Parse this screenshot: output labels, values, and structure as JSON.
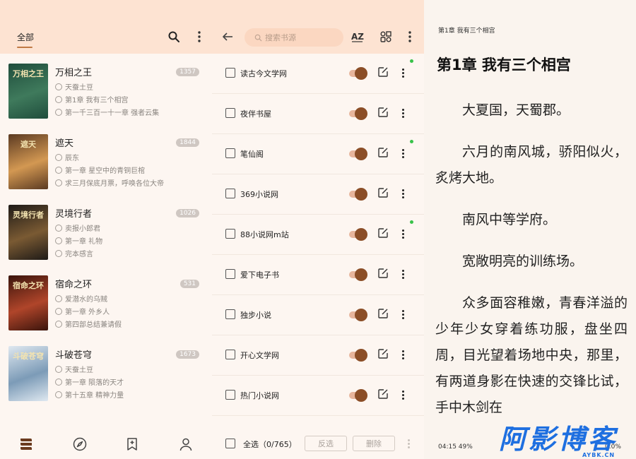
{
  "bookshelf": {
    "tab_all": "全部",
    "icons": {
      "search": "search-icon",
      "more": "more-vert-icon"
    },
    "books": [
      {
        "title": "万相之王",
        "count": "1357",
        "author": "天蚕土豆",
        "read_chapter": "第1章 我有三个相宫",
        "latest_chapter": "第一千三百一十一章 强者云集",
        "cover_text": "万相之王",
        "cover_colors": [
          "#1f4d3c",
          "#3f7a5c"
        ]
      },
      {
        "title": "遮天",
        "count": "1844",
        "author": "辰东",
        "read_chapter": "第一章 星空中的青铜巨棺",
        "latest_chapter": "求三月保底月票，呼唤各位大帝",
        "cover_text": "遮天",
        "cover_colors": [
          "#5b3a22",
          "#d39852"
        ]
      },
      {
        "title": "灵境行者",
        "count": "1026",
        "author": "卖报小郎君",
        "read_chapter": "第一章 礼物",
        "latest_chapter": "完本感言",
        "cover_text": "灵境行者",
        "cover_colors": [
          "#1e1a17",
          "#7a5a33"
        ]
      },
      {
        "title": "宿命之环",
        "count": "531",
        "author": "爱潜水的乌贼",
        "read_chapter": "第一章 外乡人",
        "latest_chapter": "第四部总结兼请假",
        "cover_text": "宿命之环",
        "cover_colors": [
          "#3a140c",
          "#b0452a"
        ]
      },
      {
        "title": "斗破苍穹",
        "count": "1673",
        "author": "天蚕土豆",
        "read_chapter": "第一章 陨落的天才",
        "latest_chapter": "第十五章 精神力量",
        "cover_text": "斗破苍穹",
        "cover_colors": [
          "#dfe8f0",
          "#7c9bb7"
        ]
      }
    ],
    "nav_icons": [
      "bookshelf-icon",
      "explore-icon",
      "bookmark-icon",
      "profile-icon"
    ]
  },
  "sources": {
    "search_placeholder": "搜索书源",
    "icons": {
      "back": "arrow-left-icon",
      "sort": "sort-az-icon",
      "group": "group-icon",
      "more": "more-vert-icon"
    },
    "items": [
      {
        "name": "读古今文学网",
        "enabled": true,
        "dot": true
      },
      {
        "name": "夜伴书屋",
        "enabled": true,
        "dot": false
      },
      {
        "name": "笔仙阁",
        "enabled": true,
        "dot": true
      },
      {
        "name": "369小说网",
        "enabled": true,
        "dot": false
      },
      {
        "name": "88小说网m站",
        "enabled": true,
        "dot": true
      },
      {
        "name": "爱下电子书",
        "enabled": true,
        "dot": false
      },
      {
        "name": "独步小说",
        "enabled": true,
        "dot": false
      },
      {
        "name": "开心文学网",
        "enabled": true,
        "dot": false
      },
      {
        "name": "热门小说网",
        "enabled": true,
        "dot": false
      }
    ],
    "footer": {
      "select_all": "全选（0/765）",
      "invert": "反选",
      "delete": "删除"
    },
    "colors": {
      "toggle_knob": "#8b4e27",
      "toggle_track": "#e7b59c",
      "dot": "#39c24a"
    }
  },
  "reader": {
    "header": "第1章 我有三个相宫",
    "chapter_title": "第1章 我有三个相宫",
    "paragraphs": [
      "大夏国，天蜀郡。",
      "六月的南风城，骄阳似火，炙烤大地。",
      "南风中等学府。",
      "宽敞明亮的训练场。",
      "众多面容稚嫩，青春洋溢的少年少女穿着练功服，盘坐四周，目光望着场地中央，那里，有两道身影在快速的交锋比试，手中木剑在"
    ],
    "status_left": "04:15 49%",
    "status_right": "0.0%",
    "watermark": "阿影博客",
    "watermark_sub": "AYBK.CN"
  }
}
